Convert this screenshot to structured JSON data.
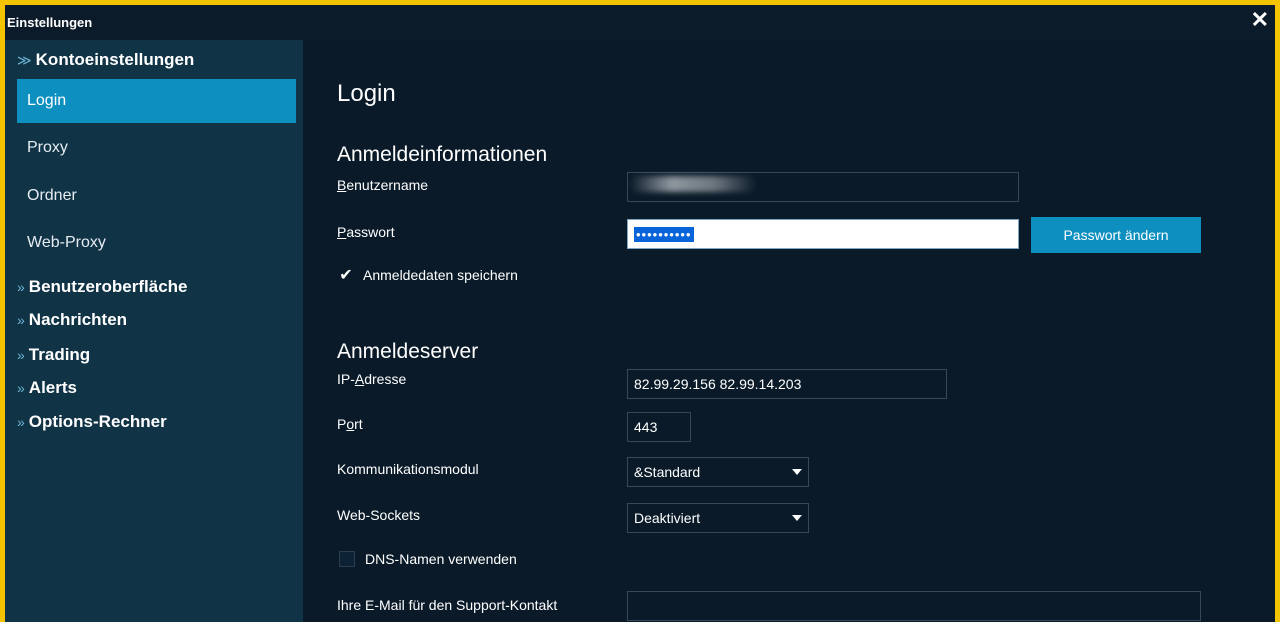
{
  "window": {
    "title": "Einstellungen",
    "close_glyph": "✕"
  },
  "sidebar": {
    "groups": [
      {
        "label": "Kontoeinstellungen",
        "chevron": "≫",
        "expanded": true
      },
      {
        "label": "Benutzeroberfläche",
        "chevron": "»"
      },
      {
        "label": "Nachrichten",
        "chevron": "»"
      },
      {
        "label": "Trading",
        "chevron": "»"
      },
      {
        "label": "Alerts",
        "chevron": "»"
      },
      {
        "label": "Options-Rechner",
        "chevron": "»"
      }
    ],
    "items": [
      {
        "label": "Login",
        "active": true
      },
      {
        "label": "Proxy"
      },
      {
        "label": "Ordner"
      },
      {
        "label": "Web-Proxy"
      }
    ]
  },
  "main": {
    "title": "Login",
    "credentials": {
      "heading": "Anmeldeinformationen",
      "username_label_first": "B",
      "username_label_rest": "enutzername",
      "password_label_first": "P",
      "password_label_rest": "asswort",
      "password_mask": "••••••••••",
      "change_password_button": "Passwort ändern",
      "save_credentials_label": "Anmeldedaten speichern",
      "save_credentials_checked": true
    },
    "server": {
      "heading": "Anmeldeserver",
      "ip_label_pre": "IP-",
      "ip_label_u": "A",
      "ip_label_post": "dresse",
      "ip_value": "82.99.29.156 82.99.14.203",
      "port_label_pre": "P",
      "port_label_u": "o",
      "port_label_post": "rt",
      "port_value": "443",
      "comm_label": "Kommunikationsmodul",
      "comm_value": "&Standard",
      "websockets_label": "Web-Sockets",
      "websockets_value": "Deaktiviert",
      "dns_label": "DNS-Namen verwenden",
      "dns_checked": false,
      "email_label": "Ihre E-Mail für den Support-Kontakt",
      "email_value": ""
    }
  },
  "colors": {
    "accent": "#0d8fc0",
    "sidebar_bg": "#103346",
    "main_bg": "#0a1a28",
    "frame": "#f5c400"
  }
}
